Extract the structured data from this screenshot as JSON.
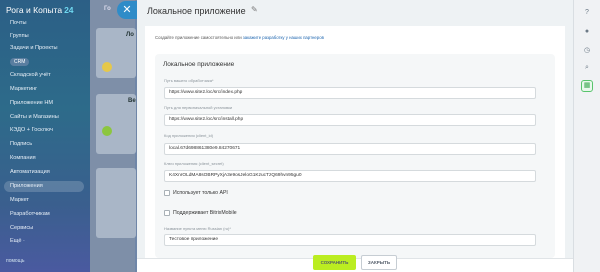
{
  "sidebar": {
    "logo_text": "Рога и Копыта",
    "logo_num": "24",
    "items": [
      {
        "label": "Почты"
      },
      {
        "label": "Группы"
      },
      {
        "label": "Задачи и Проекты"
      },
      {
        "label": "CRM"
      },
      {
        "label": "Складской учёт"
      },
      {
        "label": "Маркетинг"
      },
      {
        "label": "Приложение НМ"
      },
      {
        "label": "Сайты и Магазины"
      },
      {
        "label": "КЭДО + Госключ"
      },
      {
        "label": "Подпись"
      },
      {
        "label": "Компания"
      },
      {
        "label": "Автоматизация"
      },
      {
        "label": "Приложения"
      },
      {
        "label": "Маркет"
      },
      {
        "label": "Разработчикам"
      },
      {
        "label": "Сервисы"
      },
      {
        "label": "Ещё ·"
      }
    ],
    "help_label": "помощь"
  },
  "background_page": {
    "labels": [
      "Го",
      "Ло",
      "Ве"
    ],
    "accent_colors": [
      "#e6c84a",
      "#8cc63f",
      "#f2a03d"
    ]
  },
  "panel": {
    "title": "Локальное приложение",
    "intro_text": "Создайте приложение самостоятельно или ",
    "intro_link": "закажите разработку у наших партнеров",
    "section_title": "Локальное приложение",
    "fields": [
      {
        "label": "Путь вашего обработчика*",
        "value": "https://www.site2.loc/src/index.php"
      },
      {
        "label": "Путь для первоначальной установки",
        "value": "https://www.site2.loc/src/install.php"
      },
      {
        "label": "Код приложения (client_id)",
        "value": "local.67d698861380e9.84270671"
      },
      {
        "label": "Ключ приложения (client_secret)",
        "value": "K4XnrOLdMA8sOBRPyXjA3e9osJeloG1KzucTzQ69hvn95gu0"
      }
    ],
    "checkbox_api_only": "Использует только API",
    "checkbox_mobile": "Поддерживает BitrixMobile",
    "menu_label": "Название пункта меню Russian (ru)*",
    "menu_value": "Тестовое приложение",
    "save_button": "СОХРАНИТЬ",
    "close_button": "ЗАКРЫТЬ"
  },
  "right_toolbar": {
    "icons": [
      "help-icon",
      "bell-icon",
      "clock-icon",
      "search-icon",
      "apps-icon"
    ]
  }
}
